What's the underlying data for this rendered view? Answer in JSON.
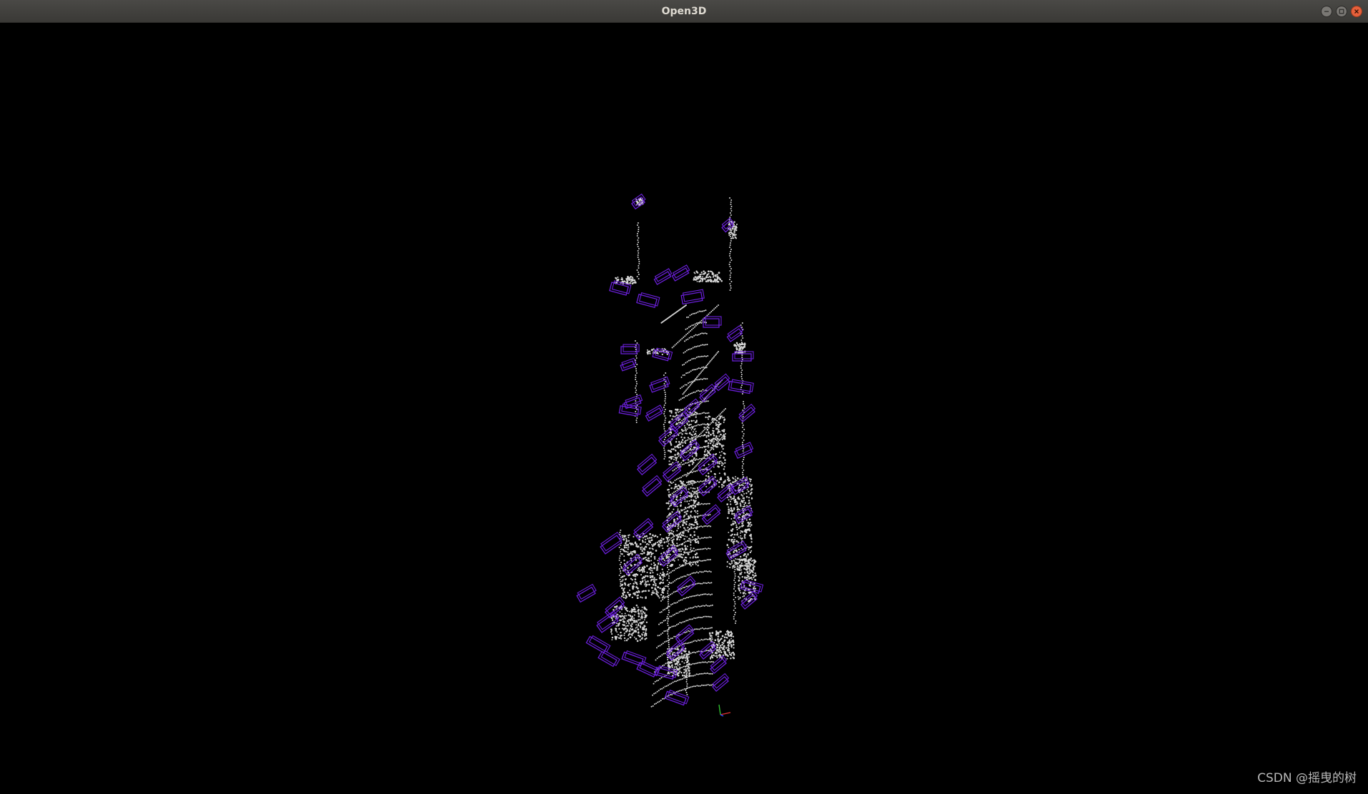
{
  "window": {
    "title": "Open3D",
    "controls": {
      "minimize_icon": "minimize-icon",
      "maximize_icon": "maximize-icon",
      "close_icon": "close-icon"
    }
  },
  "viewport": {
    "background": "#000000",
    "point_color": "#d6d6d6",
    "box_color": "#6a1fd8",
    "axes_colors": {
      "x": "#e03030",
      "y": "#30c030",
      "z": "#3050ff"
    }
  },
  "watermark": "CSDN @摇曳的树"
}
